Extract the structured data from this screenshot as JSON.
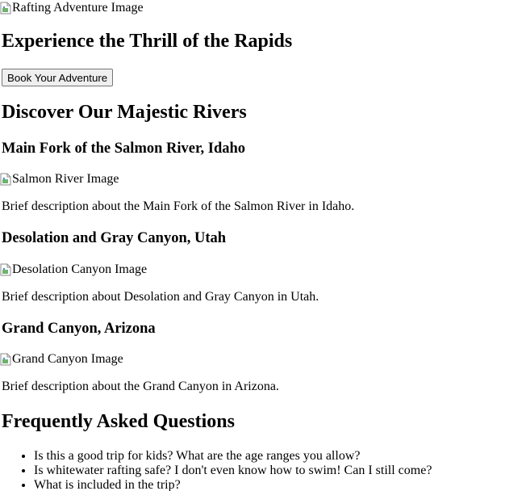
{
  "hero": {
    "image_alt": "Rafting Adventure Image",
    "title": "Experience the Thrill of the Rapids",
    "cta_label": "Book Your Adventure"
  },
  "rivers": {
    "heading": "Discover Our Majestic Rivers",
    "items": [
      {
        "title": "Main Fork of the Salmon River, Idaho",
        "image_alt": "Salmon River Image",
        "description": "Brief description about the Main Fork of the Salmon River in Idaho."
      },
      {
        "title": "Desolation and Gray Canyon, Utah",
        "image_alt": "Desolation Canyon Image",
        "description": "Brief description about Desolation and Gray Canyon in Utah."
      },
      {
        "title": "Grand Canyon, Arizona",
        "image_alt": "Grand Canyon Image",
        "description": "Brief description about the Grand Canyon in Arizona."
      }
    ]
  },
  "faq": {
    "heading": "Frequently Asked Questions",
    "questions": [
      "Is this a good trip for kids? What are the age ranges you allow?",
      "Is whitewater rafting safe? I don't even know how to swim! Can I still come?",
      "What is included in the trip?"
    ]
  },
  "icons": {
    "broken_image": "broken-image-icon"
  }
}
